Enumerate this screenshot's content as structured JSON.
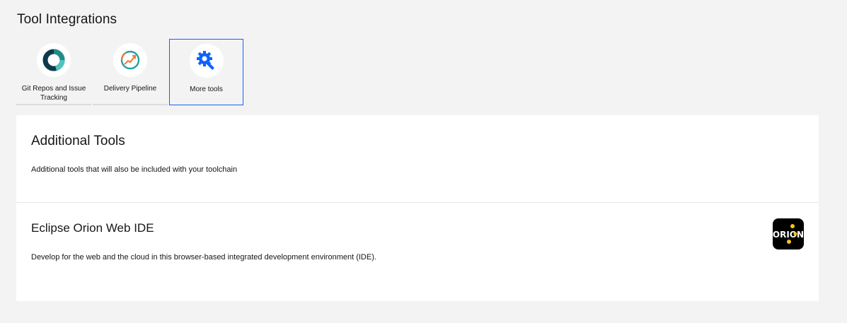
{
  "page": {
    "title": "Tool Integrations"
  },
  "tiles": [
    {
      "label": "Git Repos and Issue Tracking",
      "icon": "git-repos-icon"
    },
    {
      "label": "Delivery Pipeline",
      "icon": "delivery-pipeline-icon"
    },
    {
      "label": "More tools",
      "icon": "more-tools-icon",
      "selected": true
    }
  ],
  "additional": {
    "title": "Additional Tools",
    "description": "Additional tools that will also be included with your toolchain"
  },
  "tool": {
    "title": "Eclipse Orion Web IDE",
    "description": "Develop for the web and the cloud in this browser-based integrated development environment (IDE).",
    "logo_text": "ORION"
  },
  "colors": {
    "accent": "#0f62fe",
    "background": "#f3f3f3",
    "panel": "#ffffff"
  }
}
